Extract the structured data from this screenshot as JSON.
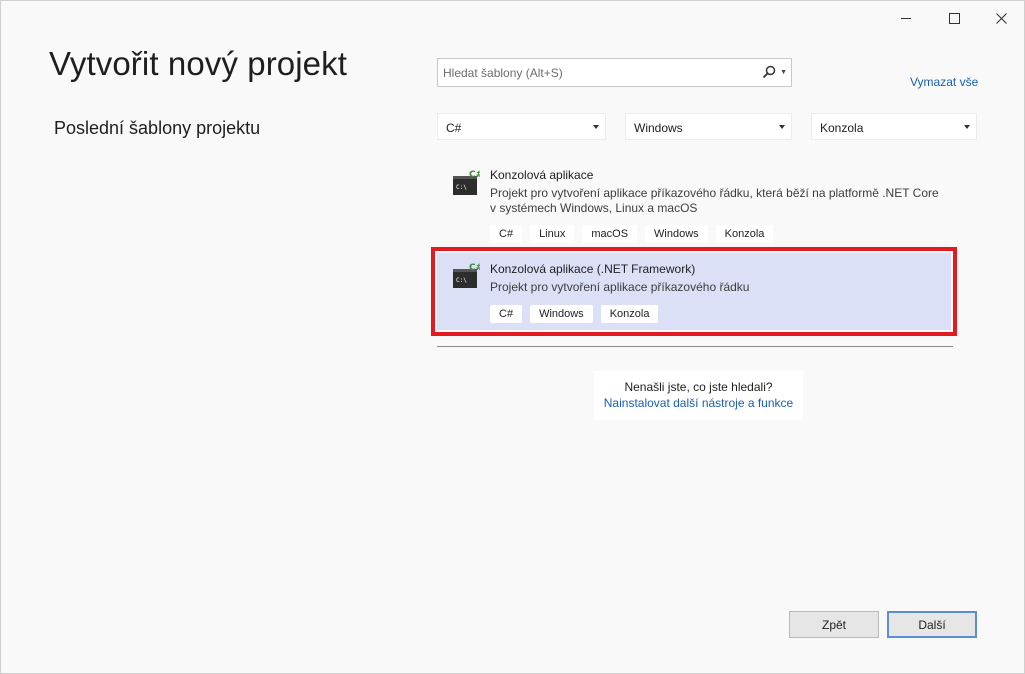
{
  "window": {
    "minimize_icon": "minimize-icon",
    "maximize_icon": "maximize-icon",
    "close_icon": "close-icon"
  },
  "page_title": "Vytvořit nový projekt",
  "recent_heading": "Poslední šablony projektu",
  "search": {
    "placeholder": "Hledat šablony (Alt+S)",
    "icon": "search-icon"
  },
  "clear_all": "Vymazat vše",
  "filters": {
    "language": "C#",
    "platform": "Windows",
    "project_type": "Konzola"
  },
  "templates": [
    {
      "name": "Konzolová aplikace",
      "description": "Projekt pro vytvoření aplikace příkazového řádku, která běží na platformě .NET Core v systémech Windows, Linux a macOS",
      "tags": [
        "C#",
        "Linux",
        "macOS",
        "Windows",
        "Konzola"
      ],
      "selected": false
    },
    {
      "name": "Konzolová aplikace (.NET Framework)",
      "description": "Projekt pro vytvoření aplikace příkazového řádku",
      "tags": [
        "C#",
        "Windows",
        "Konzola"
      ],
      "selected": true
    }
  ],
  "not_found": {
    "question": "Nenašli jste, co jste hledali?",
    "link": "Nainstalovat další nástroje a funkce"
  },
  "buttons": {
    "back": "Zpět",
    "next": "Další"
  },
  "colors": {
    "accent_link": "#1a5fb4",
    "selection": "#dce0f7",
    "highlight_border": "#e21b23"
  }
}
